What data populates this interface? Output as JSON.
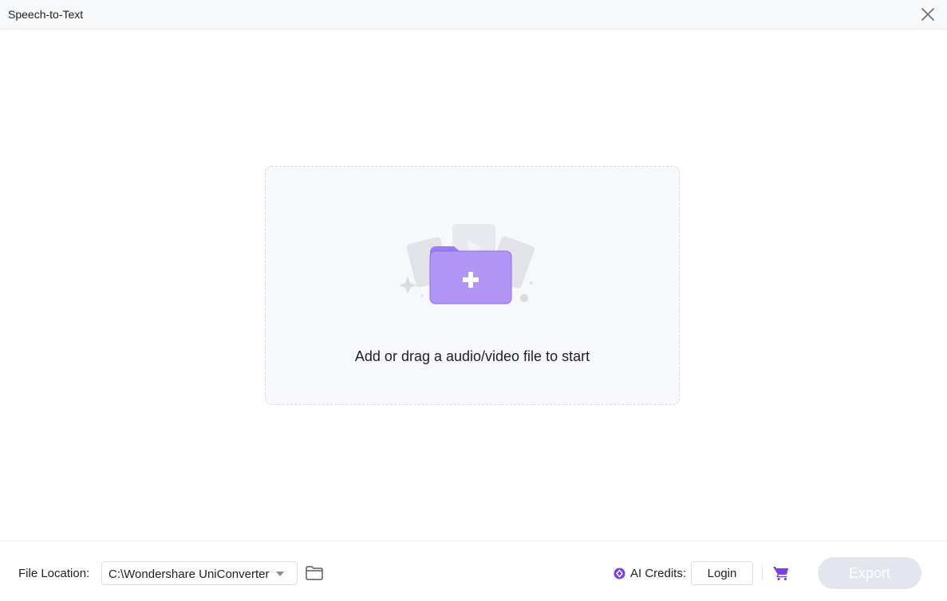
{
  "window": {
    "title": "Speech-to-Text",
    "close_icon": "close-icon"
  },
  "dropzone": {
    "prompt": "Add or drag a audio/video file to start",
    "illustration_icon": "add-folder-icon",
    "accent_color": "#a98af7"
  },
  "footer": {
    "file_location_label": "File Location:",
    "file_location_value": "C:\\Wondershare UniConverter",
    "folder_icon": "folder-icon",
    "credits_icon": "ai-credits-icon",
    "credits_label": "AI Credits:",
    "login_label": "Login",
    "cart_icon": "cart-icon",
    "export_label": "Export",
    "brand_color": "#7b3fe4"
  }
}
